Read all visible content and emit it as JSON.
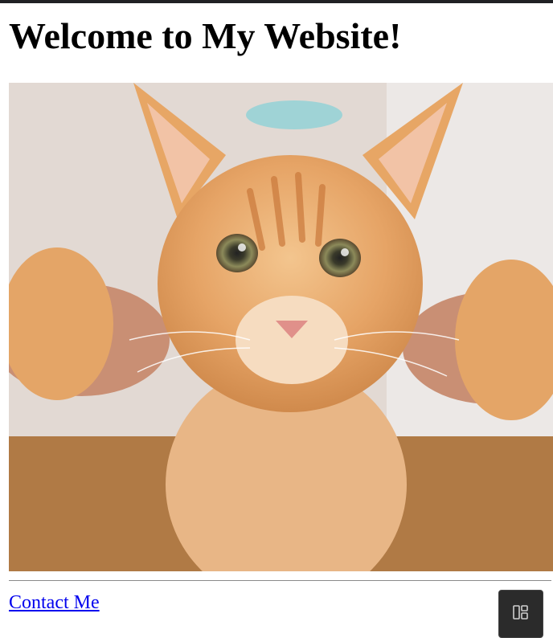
{
  "page": {
    "heading": "Welcome to My Website!",
    "contact_link": "Contact Me"
  },
  "image": {
    "subject": "orange-tabby-kitten-photo"
  },
  "floating_button": {
    "icon": "layout-panels-icon"
  },
  "colors": {
    "link": "#0000ee",
    "top_bar": "#202124",
    "floating_button_bg": "#2b2b2b",
    "kitten_fur": "#e7a665"
  }
}
